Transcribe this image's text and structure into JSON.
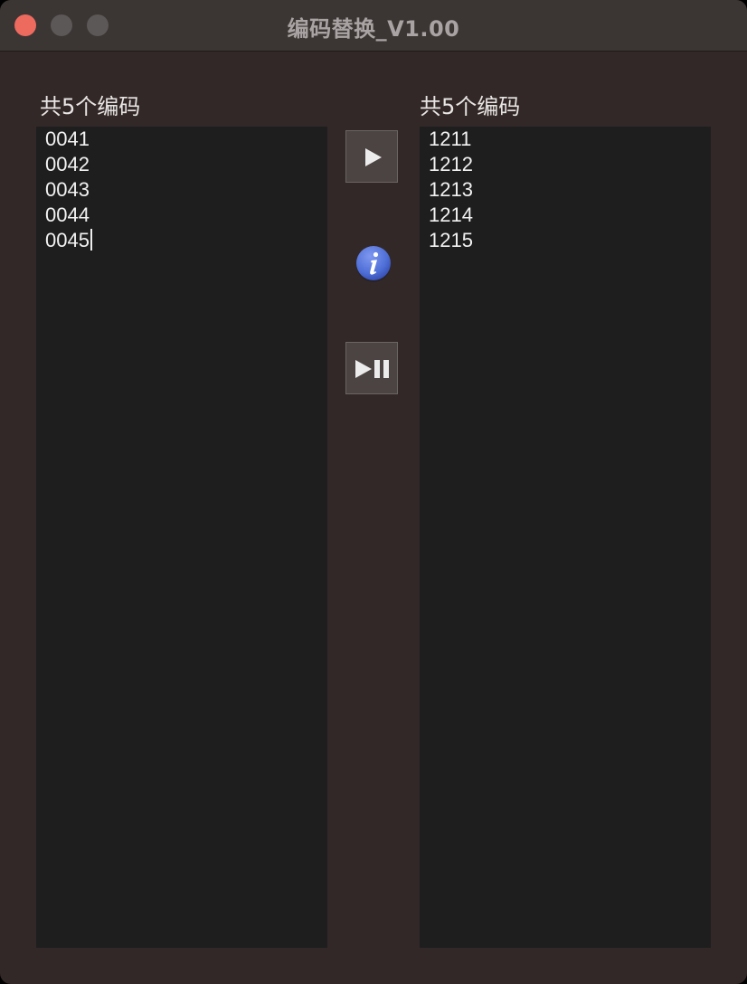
{
  "window": {
    "title": "编码替换_V1.00"
  },
  "left_panel": {
    "count_label": "共5个编码",
    "lines": [
      "0041",
      "0042",
      "0043",
      "0044",
      "0045"
    ]
  },
  "right_panel": {
    "count_label": "共5个编码",
    "lines": [
      "1211",
      "1212",
      "1213",
      "1214",
      "1215"
    ]
  },
  "controls": {
    "play_icon": "play-icon",
    "info_icon": "info-icon",
    "play_pause_icon": "play-pause-icon"
  },
  "colors": {
    "window_background": "#322827",
    "list_background": "#1e1e1e",
    "close_button": "#ed6a5e",
    "info_blue": "#4f6fd7"
  }
}
